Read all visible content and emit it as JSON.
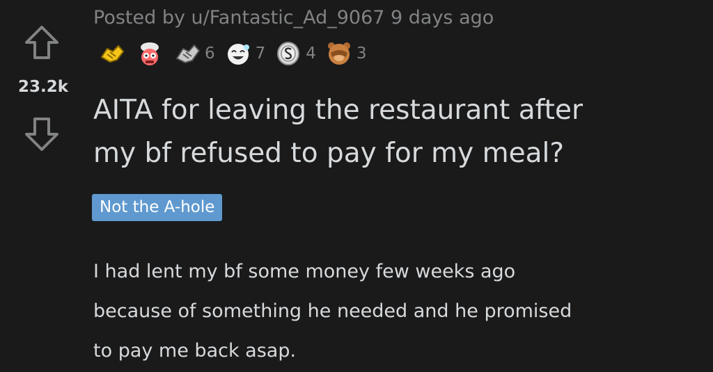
{
  "post": {
    "score": "23.2k",
    "posted_by": "Posted by u/Fantastic_Ad_9067 9 days ago",
    "title_line1": "AITA for leaving the restaurant after",
    "title_line2": "my bf refused to pay for my meal?",
    "flair": "Not the A-hole",
    "body_line1": "I had lent my bf some money few weeks ago",
    "body_line2": "because of something he needed and he promised",
    "body_line3": "to pay me back asap.",
    "awards": [
      {
        "icon": "handshake-award-icon",
        "count": ""
      },
      {
        "icon": "mind-blown-award-icon",
        "count": ""
      },
      {
        "icon": "fist-bump-award-icon",
        "count": "6"
      },
      {
        "icon": "laughing-face-award-icon",
        "count": "7"
      },
      {
        "icon": "silver-coin-award-icon",
        "count": "4"
      },
      {
        "icon": "facepalm-bear-award-icon",
        "count": "3"
      }
    ]
  },
  "colors": {
    "background": "#1a1a1b",
    "text": "#d7dadc",
    "muted": "#818384",
    "flair": "#5f99cf"
  }
}
